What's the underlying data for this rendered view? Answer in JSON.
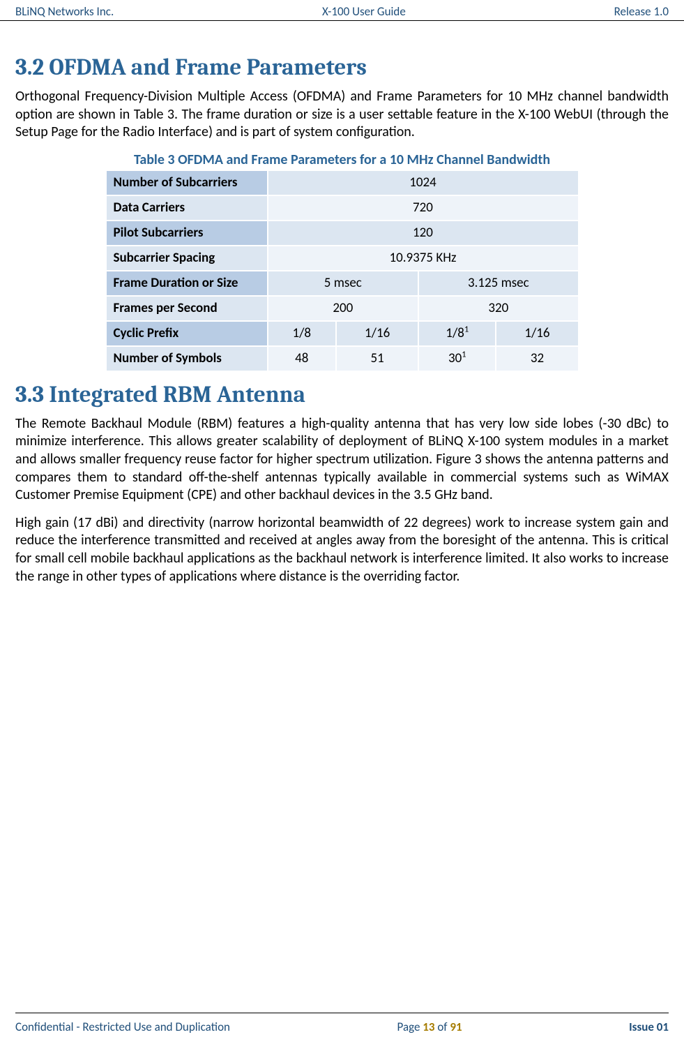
{
  "header": {
    "left": "BLiNQ Networks Inc.",
    "center": "X-100 User Guide",
    "right": "Release 1.0"
  },
  "footer": {
    "left": "Confidential - Restricted Use and Duplication",
    "center_pre": "Page ",
    "center_num": "13",
    "center_mid": " of ",
    "center_total": "91",
    "right": "Issue 01"
  },
  "s32": {
    "heading": "3.2  OFDMA and Frame Parameters",
    "para": "Orthogonal Frequency-Division Multiple Access (OFDMA) and Frame Parameters for 10 MHz channel bandwidth option are shown in Table 3. The frame duration or size is a user settable feature in the X-100 WebUI (through the Setup Page for the Radio Interface) and is part of system configuration.",
    "table_caption": "Table 3 OFDMA and Frame Parameters for a 10 MHz Channel Bandwidth",
    "rows": {
      "r1_label": "Number of Subcarriers",
      "r1_val": "1024",
      "r2_label": "Data Carriers",
      "r2_val": "720",
      "r3_label": "Pilot Subcarriers",
      "r3_val": "120",
      "r4_label": "Subcarrier Spacing",
      "r4_val": "10.9375 KHz",
      "r5_label": "Frame Duration or Size",
      "r5_c1": "5 msec",
      "r5_c2": "3.125 msec",
      "r6_label": "Frames per Second",
      "r6_c1": "200",
      "r6_c2": "320",
      "r7_label": "Cyclic Prefix",
      "r7_c1": "1/8",
      "r7_c2": "1/16",
      "r7_c3_base": "1/8",
      "r7_c3_sup": "1",
      "r7_c4": "1/16",
      "r8_label": "Number of Symbols",
      "r8_c1": "48",
      "r8_c2": "51",
      "r8_c3_base": "30",
      "r8_c3_sup": "1",
      "r8_c4": "32"
    }
  },
  "s33": {
    "heading": "3.3  Integrated RBM Antenna",
    "para1": "The Remote Backhaul Module (RBM) features a high-quality antenna that has very low side lobes (-30 dBc) to minimize interference. This allows greater scalability of deployment of BLiNQ X-100 system modules in a market and allows smaller frequency reuse factor for higher spectrum utilization. Figure 3 shows the antenna patterns and compares them to standard off-the-shelf antennas typically available in commercial systems such as WiMAX Customer Premise Equipment (CPE) and other backhaul devices in the 3.5 GHz band.",
    "para2": "High gain (17 dBi) and directivity (narrow horizontal beamwidth of 22 degrees) work to increase system gain and reduce the interference transmitted and received at angles away from the boresight of the antenna. This is critical for small cell mobile backhaul applications as the backhaul network is interference limited. It also works to increase the range in other types of applications where distance is the overriding factor."
  }
}
